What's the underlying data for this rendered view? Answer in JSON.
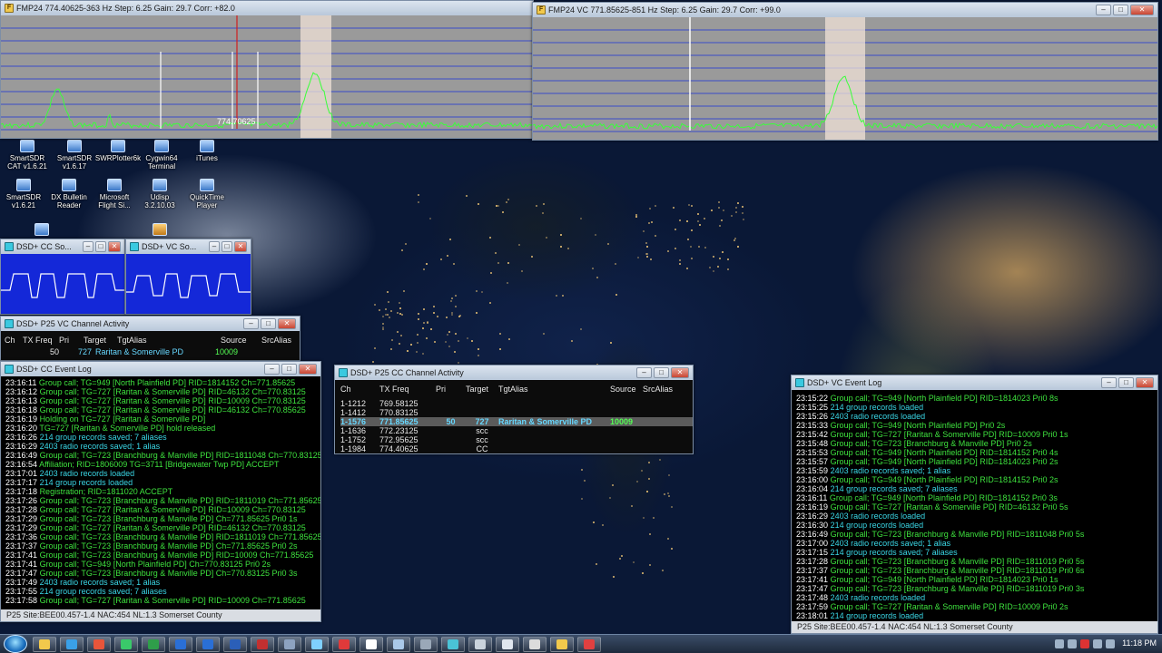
{
  "spectrum_left": {
    "title": "FMP24  774.40625-363 Hz  Step: 6.25  Gain: 29.7  Corr: +82.0",
    "center_label": "774.70625"
  },
  "spectrum_right": {
    "title": "FMP24  VC  771.85625-851 Hz  Step: 6.25  Gain: 29.7  Corr: +99.0"
  },
  "desktop_icons": [
    {
      "label": "SmartSDR\nCAT v1.6.21"
    },
    {
      "label": "SmartSDR\nv1.6.17"
    },
    {
      "label": "SWRPlotter6k"
    },
    {
      "label": "Cygwin64\nTerminal"
    },
    {
      "label": "iTunes"
    },
    {
      "label": "SmartSDR\nv1.6.21"
    },
    {
      "label": "DX Bulletin\nReader"
    },
    {
      "label": "Microsoft\nFlight Si..."
    },
    {
      "label": "Udisp\n3.2.10.03"
    },
    {
      "label": "QuickTime\nPlayer"
    }
  ],
  "scope_cc": {
    "title": "DSD+ CC So..."
  },
  "scope_vc": {
    "title": "DSD+ VC So..."
  },
  "vc_activity": {
    "title": "DSD+ P25 VC Channel Activity",
    "headers": [
      "Ch",
      "TX Freq",
      "Pri",
      "Target",
      "TgtAlias",
      "Source",
      "SrcAlias"
    ],
    "row": {
      "pri": "50",
      "target": "727",
      "alias": "Raritan & Somerville PD",
      "source": "10009"
    }
  },
  "cc_activity": {
    "title": "DSD+ P25 CC Channel Activity",
    "headers": [
      "Ch",
      "TX Freq",
      "Pri",
      "Target",
      "TgtAlias",
      "Source",
      "SrcAlias"
    ],
    "rows": [
      {
        "ch": "1-1212",
        "freq": "769.58125",
        "pri": "",
        "target": "",
        "alias": "",
        "source": ""
      },
      {
        "ch": "1-1412",
        "freq": "770.83125",
        "pri": "",
        "target": "",
        "alias": "",
        "source": ""
      },
      {
        "ch": "1-1576",
        "freq": "771.85625",
        "pri": "50",
        "target": "727",
        "alias": "Raritan & Somerville PD",
        "source": "10009",
        "highlight": true
      },
      {
        "ch": "1-1636",
        "freq": "772.23125",
        "pri": "",
        "target": "scc",
        "alias": "",
        "source": ""
      },
      {
        "ch": "1-1752",
        "freq": "772.95625",
        "pri": "",
        "target": "scc",
        "alias": "",
        "source": ""
      },
      {
        "ch": "1-1984",
        "freq": "774.40625",
        "pri": "",
        "target": "CC",
        "alias": "",
        "source": ""
      }
    ]
  },
  "cc_log": {
    "title": "DSD+ CC Event Log",
    "status": "P25  Site:BEE00.457-1.4  NAC:454  NL:1.3   Somerset County",
    "lines": [
      {
        "t": "23:16:11",
        "m": "Group call; TG=949 [North Plainfield PD] RID=1814152 Ch=771.85625"
      },
      {
        "t": "23:16:12",
        "m": "Group call; TG=727 [Raritan & Somerville PD] RID=46132 Ch=770.83125"
      },
      {
        "t": "23:16:13",
        "m": "Group call; TG=727 [Raritan & Somerville PD] RID=10009 Ch=770.83125"
      },
      {
        "t": "23:16:18",
        "m": "Group call; TG=727 [Raritan & Somerville PD] RID=46132 Ch=770.85625"
      },
      {
        "t": "23:16:19",
        "m": "Holding on TG=727 [Raritan & Somerville PD]"
      },
      {
        "t": "23:16:20",
        "m": "TG=727 [Raritan & Somerville PD]   hold released"
      },
      {
        "t": "23:16:26",
        "m": "214 group records saved; 7 aliases",
        "c": true
      },
      {
        "t": "23:16:29",
        "m": "2403 radio records saved; 1 alias",
        "c": true
      },
      {
        "t": "23:16:49",
        "m": "Group call; TG=723 [Branchburg & Manville PD] RID=1811048  Ch=770.83125"
      },
      {
        "t": "23:16:54",
        "m": "Affiliation; RID=1806009   TG=3711 [Bridgewater Twp PD]    ACCEPT"
      },
      {
        "t": "23:17:01",
        "m": "2403 radio records loaded",
        "c": true
      },
      {
        "t": "23:17:17",
        "m": "214 group records loaded",
        "c": true
      },
      {
        "t": "23:17:18",
        "m": "Registration; RID=1811020       ACCEPT"
      },
      {
        "t": "23:17:26",
        "m": "Group call; TG=723 [Branchburg & Manville PD]  RID=1811019  Ch=771.85625"
      },
      {
        "t": "23:17:28",
        "m": "Group call; TG=727 [Raritan & Somerville PD]  RID=10009  Ch=770.83125"
      },
      {
        "t": "23:17:29",
        "m": "Group call; TG=723 [Branchburg & Manville PD]  Ch=771.85625 Pri0  1s"
      },
      {
        "t": "23:17:29",
        "m": "Group call; TG=727 [Raritan & Somerville PD] RID=46132 Ch=770.83125"
      },
      {
        "t": "23:17:36",
        "m": "Group call; TG=723 [Branchburg & Manville PD] RID=1811019  Ch=771.85625"
      },
      {
        "t": "23:17:37",
        "m": "Group call; TG=723 [Branchburg & Manville PD]  Ch=771.85625 Pri0  2s"
      },
      {
        "t": "23:17:41",
        "m": "Group call; TG=723 [Branchburg & Manville PD] RID=10009  Ch=771.85625"
      },
      {
        "t": "23:17:41",
        "m": "Group call; TG=949 [North Plainfield PD]  Ch=770.83125 Pri0  2s"
      },
      {
        "t": "23:17:47",
        "m": "Group call; TG=723 [Branchburg & Manville PD]  Ch=770.83125 Pri0  3s"
      },
      {
        "t": "23:17:49",
        "m": "2403 radio records saved; 1 alias",
        "c": true
      },
      {
        "t": "23:17:55",
        "m": "214 group records saved; 7 aliases",
        "c": true
      },
      {
        "t": "23:17:58",
        "m": "Group call; TG=727 [Raritan & Somerville PD] RID=10009  Ch=771.85625"
      }
    ]
  },
  "vc_log": {
    "title": "DSD+ VC Event Log",
    "status": "P25  Site:BEE00.457-1.4  NAC:454  NL:1.3   Somerset County",
    "lines": [
      {
        "t": "23:15:22",
        "m": "Group call; TG=949 [North Plainfield PD]  RID=1814023  Pri0  8s"
      },
      {
        "t": "23:15:25",
        "m": "214 group records loaded",
        "c": true
      },
      {
        "t": "23:15:26",
        "m": "2403 radio records loaded",
        "c": true
      },
      {
        "t": "23:15:33",
        "m": "Group call; TG=949 [North Plainfield PD]   Pri0  2s"
      },
      {
        "t": "23:15:42",
        "m": "Group call; TG=727 [Raritan & Somerville PD]  RID=10009  Pri0  1s"
      },
      {
        "t": "23:15:48",
        "m": "Group call; TG=723 [Branchburg & Manville PD]   Pri0  2s"
      },
      {
        "t": "23:15:53",
        "m": "Group call; TG=949 [North Plainfield PD]  RID=1814152  Pri0  4s"
      },
      {
        "t": "23:15:57",
        "m": "Group call; TG=949 [North Plainfield PD]  RID=1814023  Pri0  2s"
      },
      {
        "t": "23:15:59",
        "m": "2403 radio records saved; 1 alias",
        "c": true
      },
      {
        "t": "23:16:00",
        "m": "Group call; TG=949 [North Plainfield PD]  RID=1814152  Pri0  2s"
      },
      {
        "t": "23:16:04",
        "m": "214 group records saved; 7 aliases",
        "c": true
      },
      {
        "t": "23:16:11",
        "m": "Group call; TG=949 [North Plainfield PD]  RID=1814152  Pri0  3s"
      },
      {
        "t": "23:16:19",
        "m": "Group call; TG=727 [Raritan & Somerville PD]  RID=46132  Pri0  5s"
      },
      {
        "t": "23:16:29",
        "m": "2403 radio records loaded",
        "c": true
      },
      {
        "t": "23:16:30",
        "m": "214 group records loaded",
        "c": true
      },
      {
        "t": "23:16:49",
        "m": "Group call; TG=723 [Branchburg & Manville PD]  RID=1811048  Pri0  5s"
      },
      {
        "t": "23:17:00",
        "m": "2403 radio records saved; 1 alias",
        "c": true
      },
      {
        "t": "23:17:15",
        "m": "214 group records saved; 7 aliases",
        "c": true
      },
      {
        "t": "23:17:28",
        "m": "Group call; TG=723 [Branchburg & Manville PD]  RID=1811019  Pri0  5s"
      },
      {
        "t": "23:17:37",
        "m": "Group call; TG=723 [Branchburg & Manville PD]  RID=1811019  Pri0  6s"
      },
      {
        "t": "23:17:41",
        "m": "Group call; TG=949 [North Plainfield PD]  RID=1814023  Pri0  1s"
      },
      {
        "t": "23:17:47",
        "m": "Group call; TG=723 [Branchburg & Manville PD]  RID=1811019  Pri0  3s"
      },
      {
        "t": "23:17:48",
        "m": "2403 radio records loaded",
        "c": true
      },
      {
        "t": "23:17:59",
        "m": "Group call; TG=727 [Raritan & Somerville PD]  RID=10009  Pri0  2s"
      },
      {
        "t": "23:18:01",
        "m": "214 group records loaded",
        "c": true
      }
    ]
  },
  "taskbar": {
    "clock": "11:18 PM",
    "apps": [
      "explorer",
      "ie",
      "chrome",
      "terminal",
      "excel",
      "photoshop",
      "outlook",
      "word",
      "media",
      "settings",
      "network",
      "radio",
      "weather",
      "smartsdr",
      "calculator",
      "dsdplus",
      "vc-log",
      "notes",
      "clock",
      "fmp24",
      "speedometer"
    ]
  }
}
